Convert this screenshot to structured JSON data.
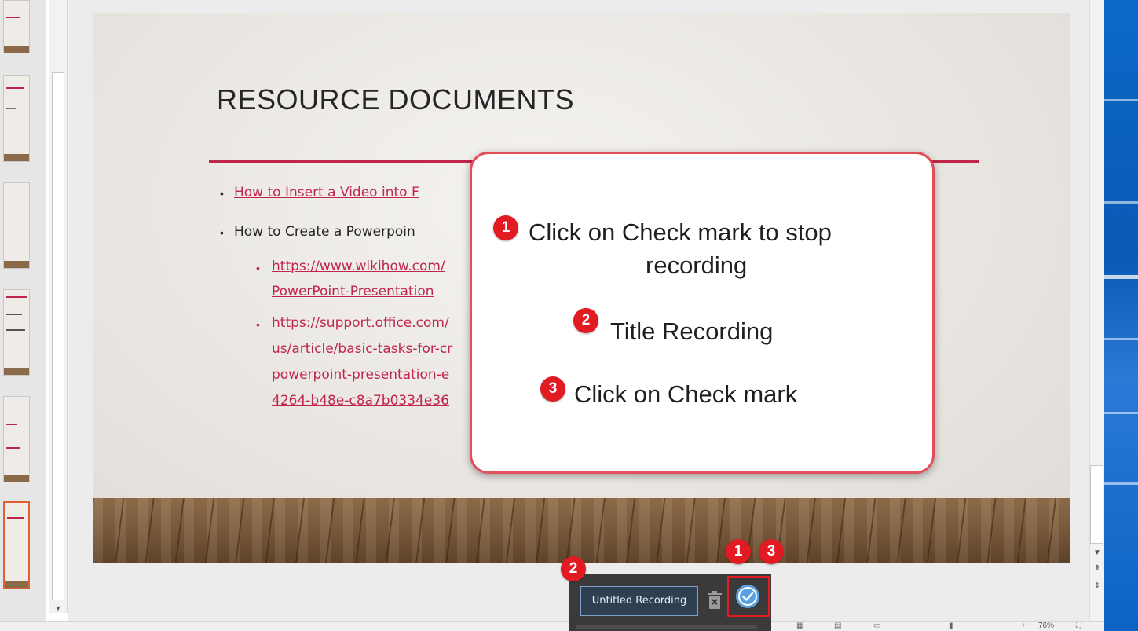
{
  "slide": {
    "title": "RESOURCE DOCUMENTS",
    "bullets": [
      {
        "text": "How to Insert a Video into F",
        "kind": "link"
      },
      {
        "text": "How to Create a Powerpoin",
        "kind": "plain"
      }
    ],
    "sub_links": [
      [
        "https://www.wikihow.com/",
        "PowerPoint-Presentation"
      ],
      [
        "https://support.office.com/",
        "us/article/basic-tasks-for-cr",
        "powerpoint-presentation-e",
        "4264-b48e-c8a7b0334e36"
      ]
    ]
  },
  "callout": {
    "step1_badge": "1",
    "step1_line1": "Click on Check mark to stop",
    "step1_line2": "recording",
    "step2_badge": "2",
    "step2_text": "Title Recording",
    "step3_badge": "3",
    "step3_text": "Click on Check mark"
  },
  "markers": {
    "title_field": "2",
    "check_first": "1",
    "check_second": "3"
  },
  "recording_bar": {
    "title_value": "Untitled Recording",
    "delete_icon": "trash-icon",
    "confirm_icon": "checkmark-circle-icon"
  },
  "status_bar": {
    "zoom": "76%"
  },
  "colors": {
    "accent": "#c0264b",
    "badge": "#e21b23",
    "callout_border": "#e24f5b",
    "check": "#5aa0e0"
  }
}
